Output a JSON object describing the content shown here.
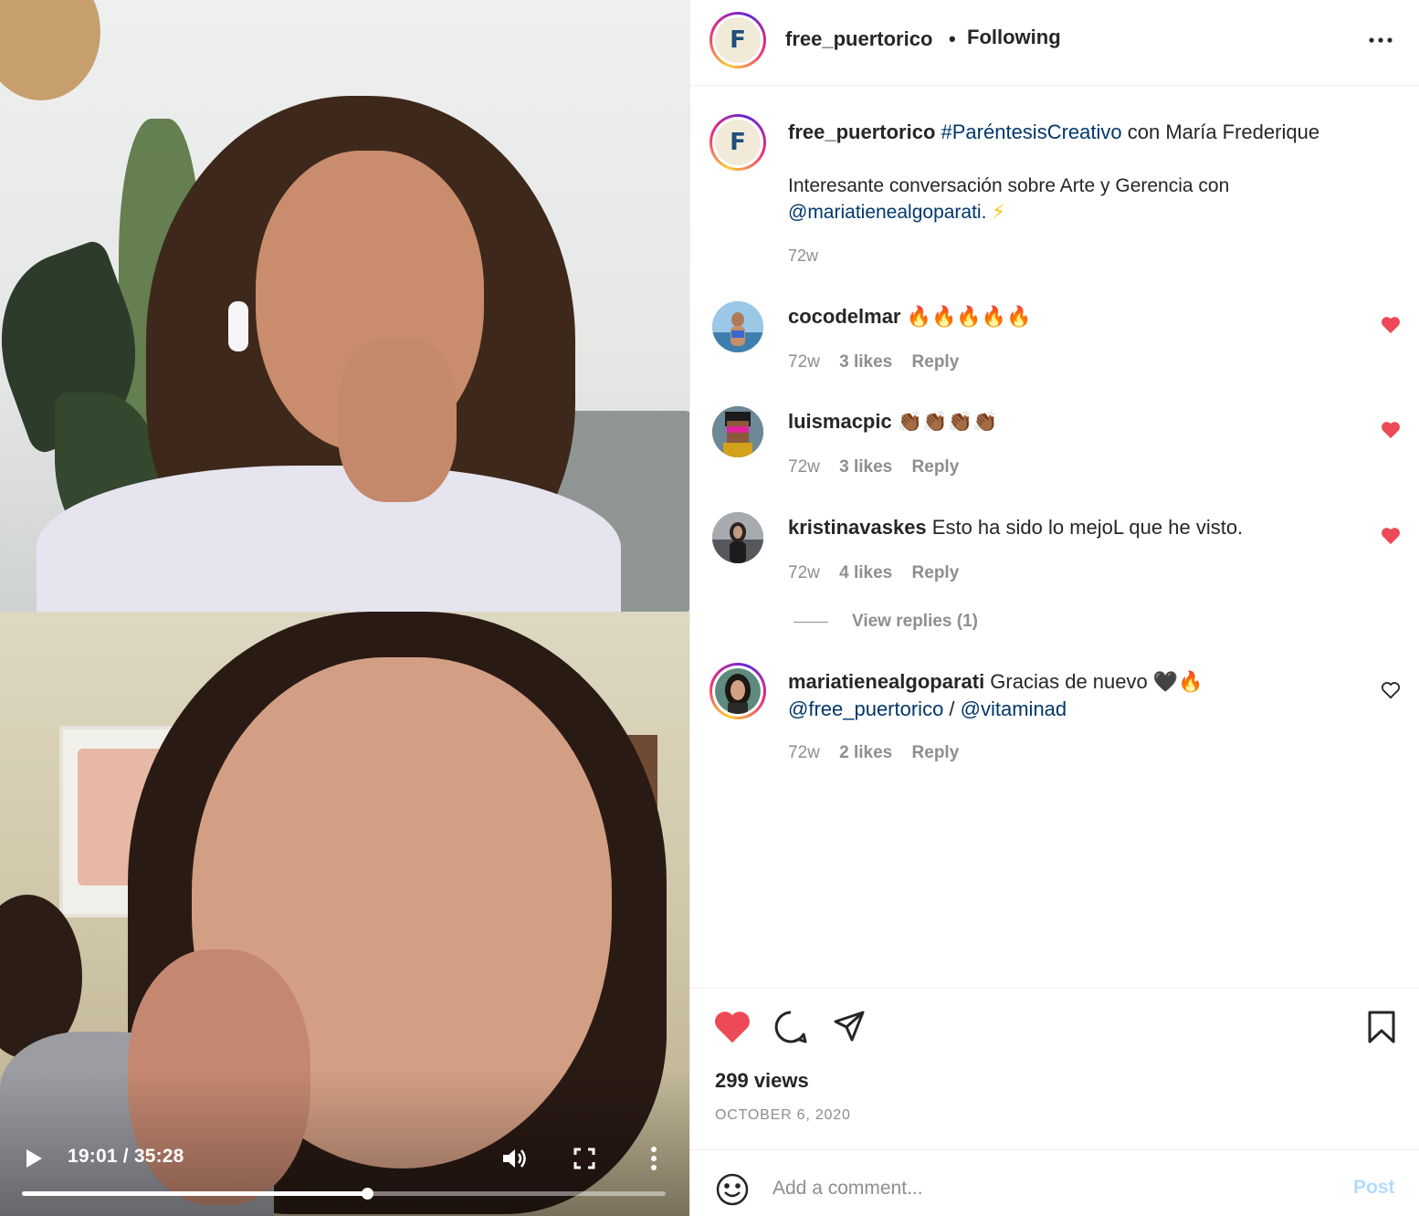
{
  "video": {
    "time_display": "19:01 / 35:28",
    "progress_fraction": 0.536
  },
  "post": {
    "username": "free_puertorico",
    "follow_status": "Following",
    "separator": "•",
    "avatar_letter": "F",
    "caption": {
      "username": "free_puertorico",
      "hashtag": "#ParéntesisCreativo",
      "headline_rest": " con María Frederique",
      "body": "Interesante conversación sobre Arte y Gerencia con ",
      "mention": "@mariatienealgoparati",
      "body_end": ". ",
      "emoji": "⚡",
      "time": "72w"
    },
    "comments": [
      {
        "username": "cocodelmar",
        "text": " 🔥🔥🔥🔥🔥",
        "time": "72w",
        "likes": "3 likes",
        "reply": "Reply",
        "liked": true,
        "avatar_color": "#6fa3c9"
      },
      {
        "username": "luismacpic",
        "text": " 👏🏾👏🏾👏🏾👏🏾",
        "time": "72w",
        "likes": "3 likes",
        "reply": "Reply",
        "liked": true,
        "avatar_color": "#5b7383"
      },
      {
        "username": "kristinavaskes",
        "text": " Esto ha sido lo mejoL que he visto.",
        "time": "72w",
        "likes": "4 likes",
        "reply": "Reply",
        "liked": true,
        "avatar_color": "#6b6e72",
        "view_replies": "View replies (1)"
      },
      {
        "username": "mariatienealgoparati",
        "text": " Gracias de nuevo 🖤🔥",
        "mention1": "@free_puertorico",
        "slash": " / ",
        "mention2": "@vitaminad",
        "time": "72w",
        "likes": "2 likes",
        "reply": "Reply",
        "liked": false,
        "avatar_color": "#4a6a63"
      }
    ],
    "views": "299 views",
    "date": "OCTOBER 6, 2020",
    "comment_placeholder": "Add a comment...",
    "post_label": "Post"
  },
  "colors": {
    "like_red": "#ed4956",
    "link_blue": "#00376b",
    "post_disabled": "#b3dbff",
    "secondary_text": "#8e8e8e"
  },
  "icons": [
    "play-icon",
    "volume-icon",
    "fullscreen-icon",
    "more-vertical-icon",
    "more-horizontal-icon",
    "heart-icon",
    "comment-icon",
    "share-icon",
    "bookmark-icon",
    "emoji-icon"
  ]
}
